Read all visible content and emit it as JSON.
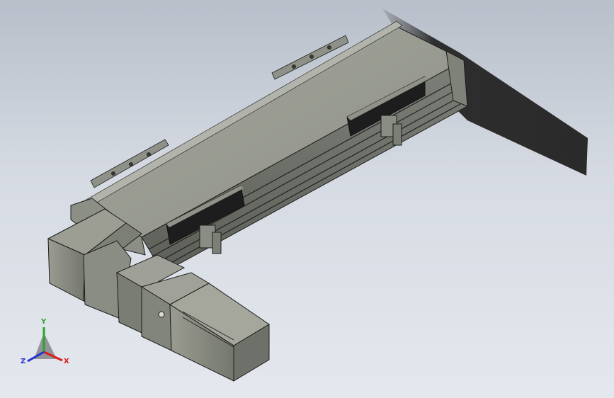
{
  "viewport": {
    "background_top": "#b8bfca",
    "background_bottom": "#e4e8ee"
  },
  "model": {
    "part_fill": "#8a8d84",
    "edge_color": "#1c1c1c",
    "shadow_color": "#2e2e2e"
  },
  "triad": {
    "x_label": "X",
    "y_label": "Y",
    "z_label": "Z",
    "x_color": "#d81e1e",
    "y_color": "#2aa52a",
    "z_color": "#2233cc"
  }
}
